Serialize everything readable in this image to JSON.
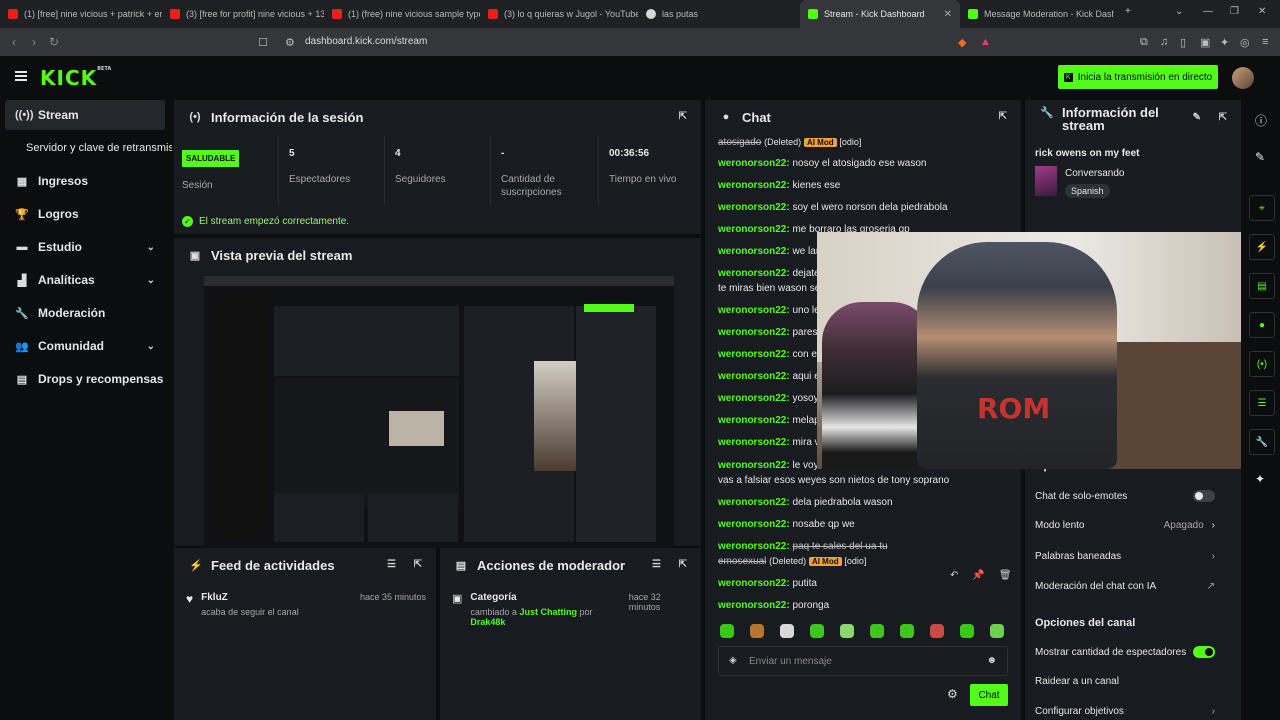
{
  "browser": {
    "tabs": [
      {
        "label": "(1) [free] nine vicious + patrick + er",
        "icon": "youtube-icon",
        "active": false
      },
      {
        "label": "(3) [free for profit] nine vicious + 13",
        "icon": "youtube-icon",
        "active": false
      },
      {
        "label": "(1) (free) nine vicious sample type b",
        "icon": "youtube-icon",
        "active": false
      },
      {
        "label": "(3) lo q quieras w Jugol - YouTube",
        "icon": "youtube-icon",
        "active": false
      },
      {
        "label": "las putas",
        "icon": "globe-icon",
        "active": false
      },
      {
        "label": "Stream - Kick Dashboard",
        "icon": "kick-icon",
        "active": true
      },
      {
        "label": "Message Moderation - Kick Dashbo",
        "icon": "kick-icon",
        "active": false
      }
    ],
    "url": "dashboard.kick.com/stream"
  },
  "header": {
    "logo": "KICK",
    "logo_sup": "BETA",
    "start_button": "Inicia la transmisión en directo"
  },
  "sidebar": {
    "items": [
      {
        "label": "Stream",
        "icon": "broadcast-icon",
        "active": true
      },
      {
        "label": "Servidor y clave de retransmisión",
        "sub": true
      },
      {
        "label": "Ingresos",
        "icon": "income-icon"
      },
      {
        "label": "Logros",
        "icon": "trophy-icon"
      },
      {
        "label": "Estudio",
        "icon": "studio-icon",
        "chevron": true
      },
      {
        "label": "Analíticas",
        "icon": "analytics-icon",
        "chevron": true
      },
      {
        "label": "Moderación",
        "icon": "wrench-icon"
      },
      {
        "label": "Comunidad",
        "icon": "community-icon",
        "chevron": true
      },
      {
        "label": "Drops y recompensas",
        "icon": "drops-icon"
      }
    ]
  },
  "session": {
    "title": "Información de la sesión",
    "status_badge": "SALUDABLE",
    "status_label": "Sesión",
    "viewers_value": "5",
    "viewers_label": "Espectadores",
    "followers_value": "4",
    "followers_label": "Seguidores",
    "subs_value": "-",
    "subs_label": "Cantidad de suscripciones",
    "time_value": "00:36:56",
    "time_label": "Tiempo en vivo",
    "ok_message": "El stream empezó correctamente."
  },
  "preview": {
    "title": "Vista previa del stream"
  },
  "feed": {
    "title": "Feed de actividades",
    "item_name": "FkluZ",
    "item_desc": "acaba de seguir el canal",
    "item_time": "hace 35 minutos"
  },
  "modactions": {
    "title": "Acciones de moderador",
    "item_name": "Categoría",
    "item_desc_pre": "cambiado a",
    "item_category": "Just Chatting",
    "item_by": "por",
    "item_user": "Drak48k",
    "item_time": "hace 32 minutos"
  },
  "chat": {
    "title": "Chat",
    "deleted_label": "(Deleted)",
    "aimod_label": "AI Mod",
    "odio_label": "[odio]",
    "first_deleted": "atosigado",
    "username": "weronorson22:",
    "messages": [
      "nosoy el atosigado ese wason",
      "kienes ese",
      "soy el wero norson dela piedrabola",
      "me borraro las groseria qp",
      "we lan",
      "dejate",
      "te miras bien wason se",
      "uno le",
      "pares",
      "con el",
      "aqui e",
      "yosoy",
      "melap",
      "mira w",
      "le voy",
      "vas a falsiar esos weyes son nietos de tony soprano",
      "dela piedrabola wason",
      "nosabe qp we",
      "paq te sales del ua tu",
      "emosexual",
      "putita",
      "poronga"
    ],
    "input_placeholder": "Enviar un mensaje",
    "send_label": "Chat"
  },
  "streaminfo": {
    "title": "Información del stream",
    "stream_title": "rick owens on my feet",
    "category": "Conversando",
    "language": "Spanish",
    "chat_options_title": "Opciones del chat",
    "emotes_only": "Chat de solo-emotes",
    "slow_mode": "Modo lento",
    "slow_mode_value": "Apagado",
    "banned_words": "Palabras baneadas",
    "ai_moderation": "Moderación del chat con IA",
    "channel_options_title": "Opciones del canal",
    "show_viewers": "Mostrar cantidad de espectadores",
    "raid": "Raidear a un canal",
    "configure_goals": "Configurar objetivos"
  },
  "webcam": {
    "shirt_text": "ROM"
  },
  "colors": {
    "accent": "#53fc18",
    "panel": "#181b1f",
    "background": "#0b0d0f",
    "ai_mod": "#f0a13a"
  }
}
